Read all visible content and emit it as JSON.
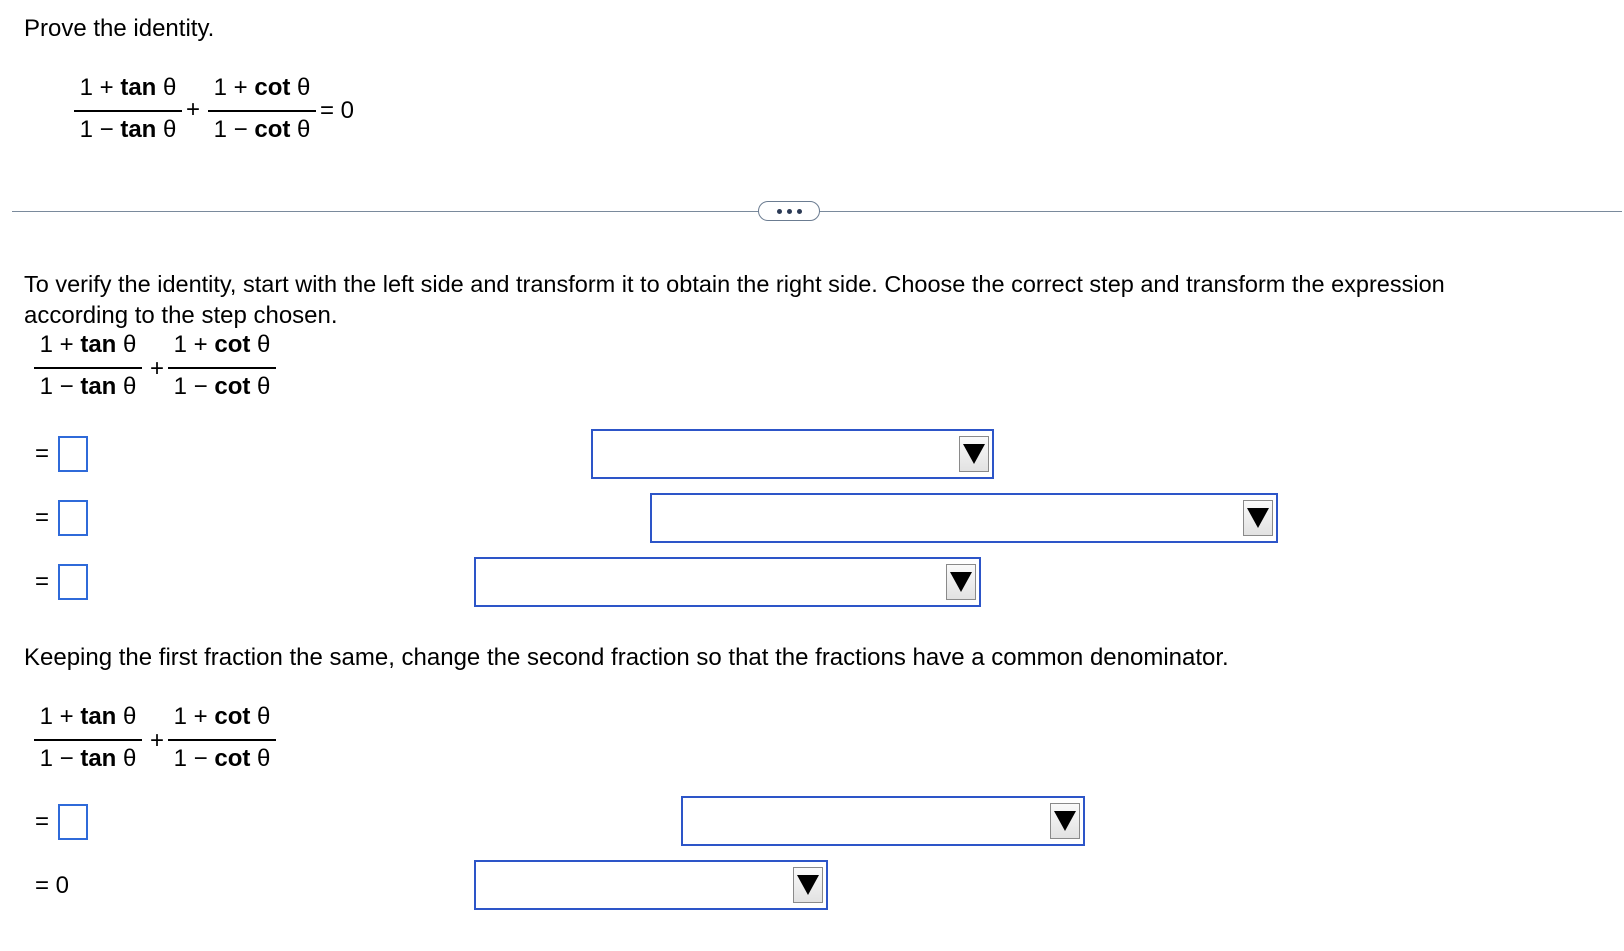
{
  "problem": {
    "instruction": "Prove the identity.",
    "identity": {
      "frac1": {
        "num_prefix": "1 + ",
        "num_func": "tan",
        "num_var": " θ",
        "den_prefix": "1 − ",
        "den_func": "tan",
        "den_var": " θ"
      },
      "plus": "+",
      "frac2": {
        "num_prefix": "1 + ",
        "num_func": "cot",
        "num_var": " θ",
        "den_prefix": "1 − ",
        "den_func": "cot",
        "den_var": " θ"
      },
      "rhs": "= 0"
    }
  },
  "divider": {
    "more_label": "..."
  },
  "step1": {
    "instruction_line1": "To verify the identity, start with the left side and transform it to obtain the right side. Choose the correct step and transform the expression",
    "instruction_line2": "according to the step chosen.",
    "equals": "=",
    "dropdowns": [
      {
        "selected": ""
      },
      {
        "selected": ""
      },
      {
        "selected": ""
      }
    ]
  },
  "step2": {
    "instruction": "Keeping the first fraction the same, change the second fraction so that the fractions have a common denominator.",
    "equals": "=",
    "final": "= 0",
    "dropdowns": [
      {
        "selected": ""
      },
      {
        "selected": ""
      }
    ]
  }
}
